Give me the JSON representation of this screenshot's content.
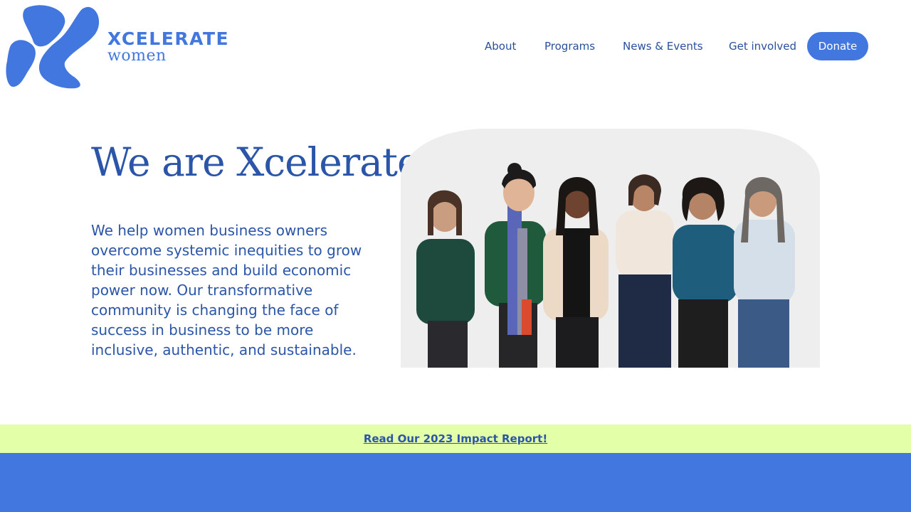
{
  "brand": {
    "name": "XCELERATE",
    "subname": "women",
    "color": "#4277df"
  },
  "nav": {
    "items": [
      {
        "label": "About"
      },
      {
        "label": "Programs"
      },
      {
        "label": "News & Events"
      },
      {
        "label": "Get involved"
      }
    ],
    "donate_label": "Donate"
  },
  "hero": {
    "title": "We are Xcelerate",
    "body": "We help women business owners overcome systemic inequities to grow their businesses and build economic power now. Our transformative community is changing the face of success in business to be more inclusive, authentic, and sustainable.",
    "image": "group-photo-six-women"
  },
  "banner": {
    "link_label": "Read Our 2023 Impact Report!",
    "background": "#e3ffa8"
  },
  "colors": {
    "text_primary": "#2a55a8",
    "footer": "#4277df"
  }
}
